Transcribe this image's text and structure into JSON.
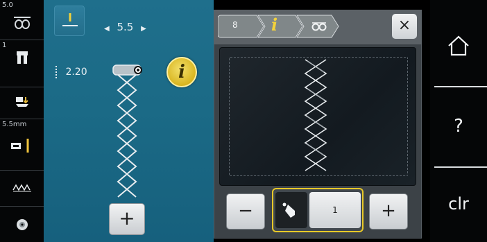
{
  "left_status": {
    "needle_value": "5.0",
    "presser_foot_number": "1",
    "stitch_plate_value": "5.5mm"
  },
  "stitch_controls": {
    "width_value": "5.5",
    "length_value": "2.20"
  },
  "info_button_label": "i",
  "add_button_label": "+",
  "dialog": {
    "breadcrumb_first": "8",
    "breadcrumb_second": "i",
    "close_label": "×",
    "minus_label": "−",
    "plus_label": "+",
    "repeat_value": "1"
  },
  "right_nav": {
    "help_label": "?",
    "clr_label": "clr"
  }
}
